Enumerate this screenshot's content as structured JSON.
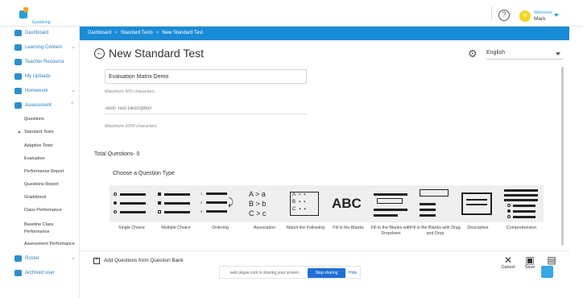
{
  "app": {
    "logo_text": "Epsebring"
  },
  "topbar": {
    "help_icon": "help-circle-icon",
    "avatar_initial": "M",
    "welcome_label": "Welcome",
    "user_name": "Mark"
  },
  "sidebar": {
    "items": [
      {
        "label": "Dashboard",
        "icon": "monitor-icon"
      },
      {
        "label": "Learning Content",
        "icon": "book-icon"
      },
      {
        "label": "Teacher Resource",
        "icon": "folder-icon"
      },
      {
        "label": "My Uploads",
        "icon": "upload-folder-icon"
      },
      {
        "label": "Homework",
        "icon": "pencil-icon"
      },
      {
        "label": "Assessment",
        "icon": "checkbox-icon"
      },
      {
        "label": "Roster",
        "icon": "calendar-icon"
      },
      {
        "label": "Archived user",
        "icon": "archive-icon"
      }
    ],
    "assessment_sub": [
      "Questions",
      "Standard Tests",
      "Adaptive Tests",
      "Evaluation",
      "Performance Report",
      "Questions Report",
      "Gradebook",
      "Class Performance",
      "Baseline Class",
      "Performance",
      "Assessment Performance"
    ]
  },
  "breadcrumb": {
    "items": [
      "Dashboard",
      "Standard Tests",
      "New Standard Test"
    ],
    "separator": ">"
  },
  "header": {
    "title": "New Standard Test",
    "language": "English"
  },
  "form": {
    "name_value": "Evaluation Matrix Demo",
    "name_hint": "Maximum 500 characters",
    "description_placeholder": "Tests Test Description",
    "description_hint": "Maximum 1000 characters",
    "total_questions": "Total Questions- 0",
    "choose_type": "Choose a Question Type"
  },
  "question_types": [
    "Single Choice",
    "Multiple Choice",
    "Ordering",
    "Association",
    "Match the Following",
    "Fill in the Blanks",
    "Fill in the Blanks with Dropdown",
    "Fill in the Blanks with Drag and Drop",
    "Descriptive",
    "Comprehension"
  ],
  "association_glyphs": {
    "row1": "A > a",
    "row2": "B > b",
    "row3": "C > c"
  },
  "fib_glyph": "ABC",
  "bottom": {
    "add_from_bank": "Add Questions from Question Bank",
    "cancel": "Cancel",
    "save": "Save"
  },
  "screen_share": {
    "text": "web.skype.com is sharing your screen.",
    "stop_label": "Stop sharing",
    "hide_label": "Hide"
  },
  "colors": {
    "brand_blue": "#1a8bd6",
    "accent_yellow": "#f3d51f"
  }
}
